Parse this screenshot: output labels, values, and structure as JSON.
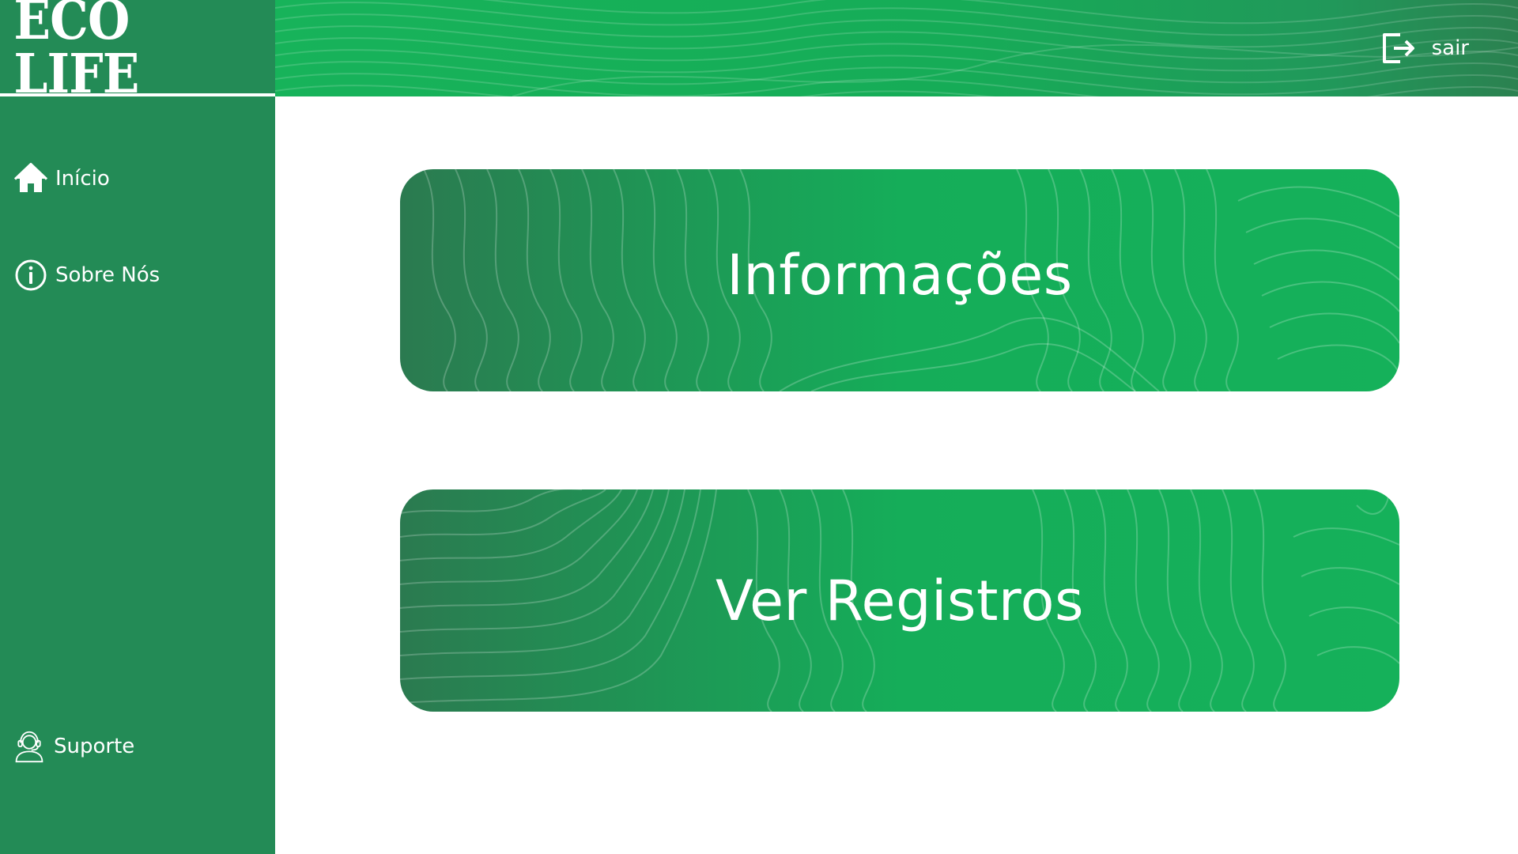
{
  "app": {
    "brand": "ECO LIFE"
  },
  "sidebar": {
    "items": [
      {
        "label": "Início",
        "icon": "home-icon"
      },
      {
        "label": "Sobre Nós",
        "icon": "info-icon"
      },
      {
        "label": "Suporte",
        "icon": "support-headset-icon"
      }
    ]
  },
  "header": {
    "logout_label": "sair",
    "logout_icon": "logout-icon"
  },
  "main": {
    "cards": [
      {
        "label": "Informações"
      },
      {
        "label": "Ver Registros"
      }
    ]
  },
  "colors": {
    "sidebar": "#238b56",
    "header_light": "#17b35a",
    "header_dark": "#2b8150",
    "card_light": "#15b15a",
    "card_dark": "#2b7a50",
    "text": "#ffffff"
  }
}
